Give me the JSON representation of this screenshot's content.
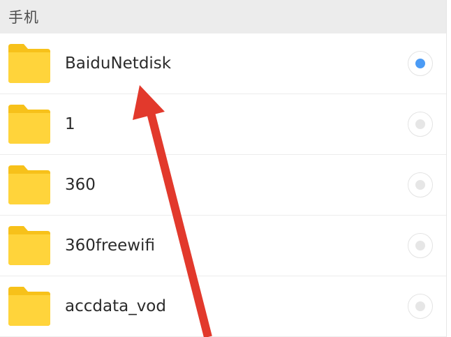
{
  "header": {
    "title": "手机"
  },
  "folders": [
    {
      "name": "BaiduNetdisk",
      "selected": true
    },
    {
      "name": "1",
      "selected": false
    },
    {
      "name": "360",
      "selected": false
    },
    {
      "name": "360freewifi",
      "selected": false
    },
    {
      "name": "accdata_vod",
      "selected": false
    }
  ],
  "colors": {
    "folder": "#FFD43B",
    "folder_tab": "#F7C11A",
    "radio_selected": "#4b9bf5",
    "arrow": "#E2392C"
  },
  "icons": {
    "folder": "folder-icon",
    "radio": "radio-button",
    "annotation": "red-arrow"
  }
}
